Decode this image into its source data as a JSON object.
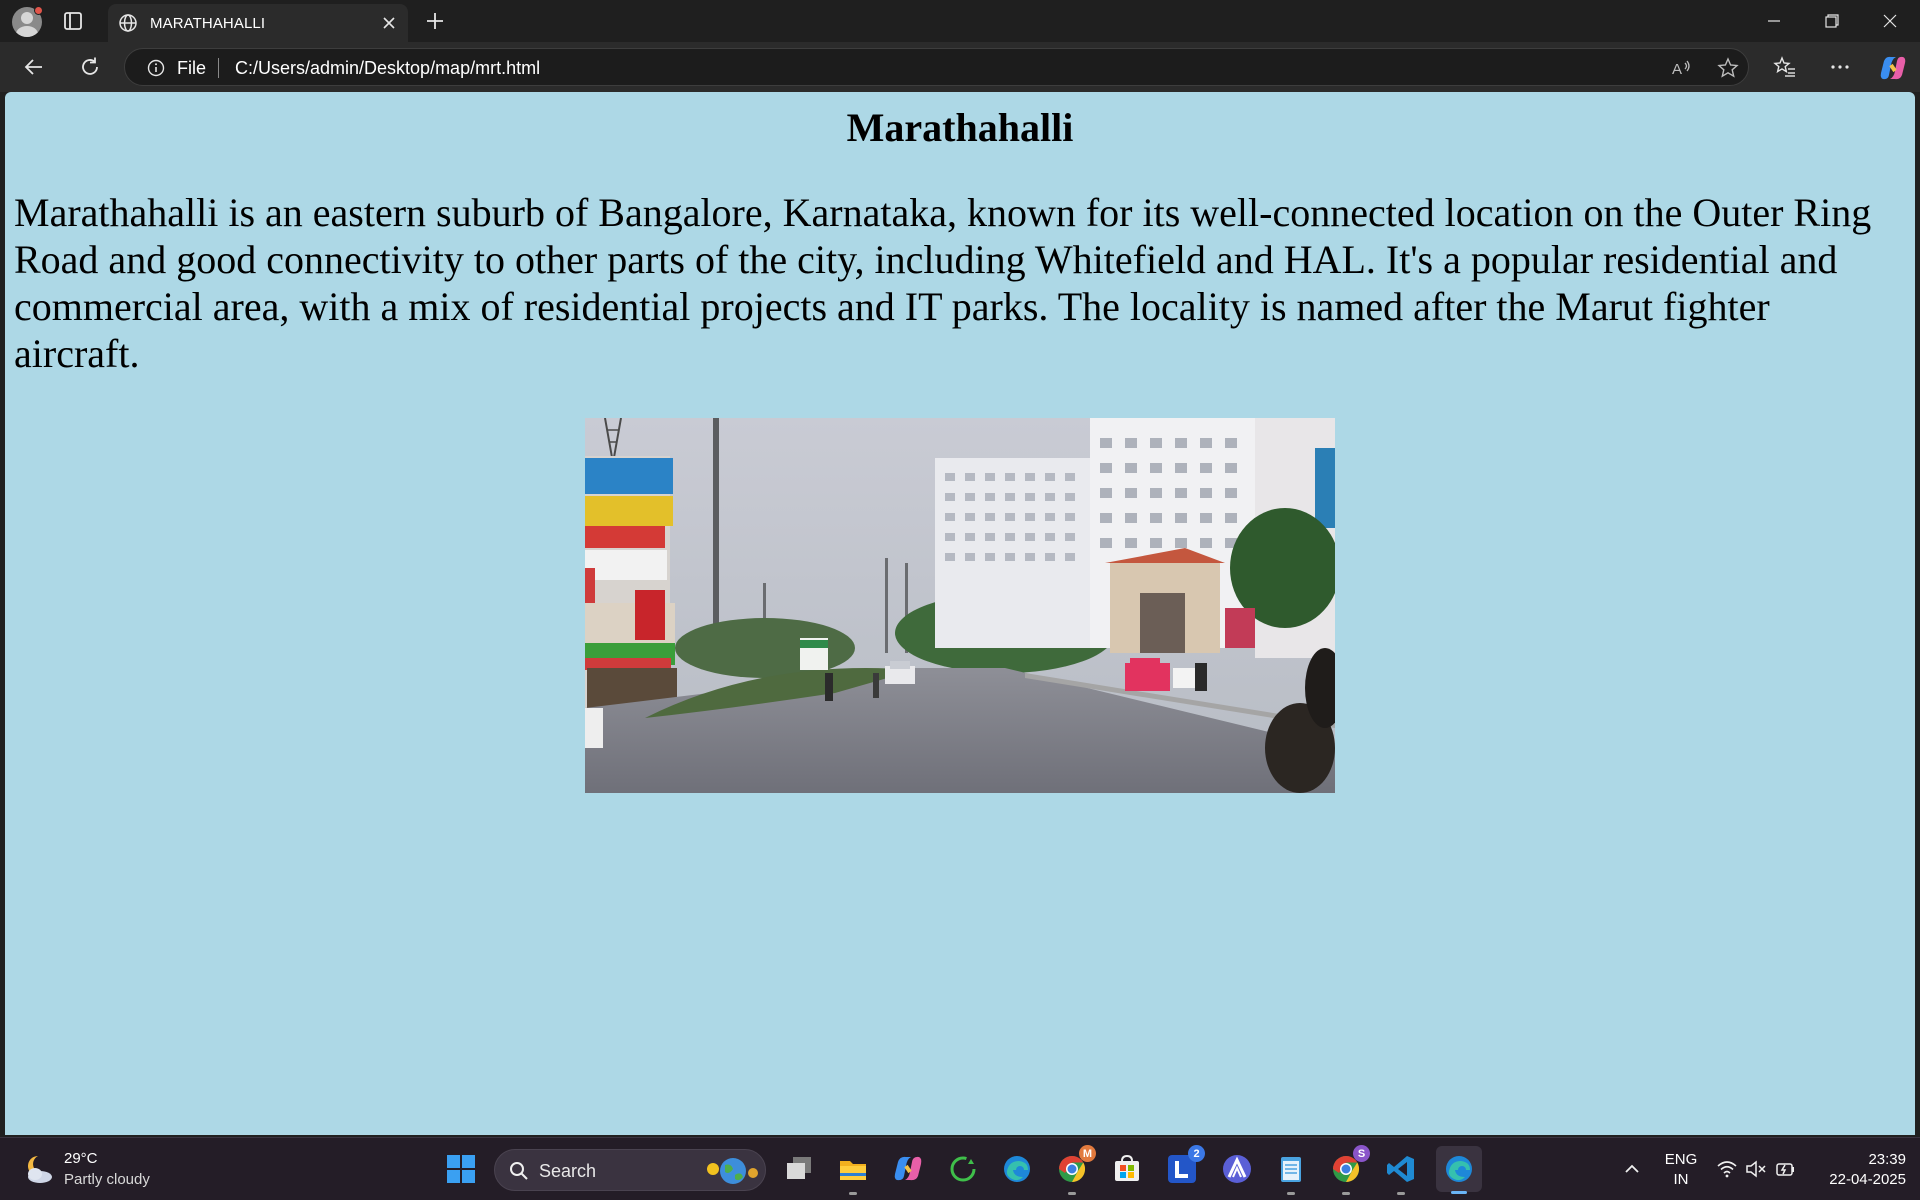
{
  "browser": {
    "tab_title": "MARATHAHALLI",
    "address_scheme_label": "File",
    "address_url": "C:/Users/admin/Desktop/map/mrt.html"
  },
  "page": {
    "background_color": "#add8e6",
    "heading": "Marathahalli",
    "description": "Marathahalli is an eastern suburb of Bangalore, Karnataka, known for its well-connected location on the Outer Ring Road and good connectivity to other parts of the city, including Whitefield and HAL. It's a popular residential and commercial area, with a mix of residential projects and IT parks. The locality is named after the Marut fighter aircraft."
  },
  "taskbar": {
    "weather_temp": "29°C",
    "weather_desc": "Partly cloudy",
    "search_label": "Search",
    "apps": [
      {
        "name": "windows-start-icon"
      },
      {
        "name": "task-view-icon"
      },
      {
        "name": "file-explorer-icon"
      },
      {
        "name": "copilot-icon"
      },
      {
        "name": "refresh-app-icon"
      },
      {
        "name": "edge-icon"
      },
      {
        "name": "chrome-profile-m-icon",
        "badge": "M"
      },
      {
        "name": "microsoft-store-icon"
      },
      {
        "name": "l-app-icon",
        "badge": "2"
      },
      {
        "name": "a-app-icon"
      },
      {
        "name": "notepad-icon"
      },
      {
        "name": "chrome-profile-s-icon",
        "badge": "S"
      },
      {
        "name": "vscode-icon"
      },
      {
        "name": "edge-active-icon"
      }
    ],
    "language_line1": "ENG",
    "language_line2": "IN",
    "time": "23:39",
    "date": "22-04-2025"
  }
}
